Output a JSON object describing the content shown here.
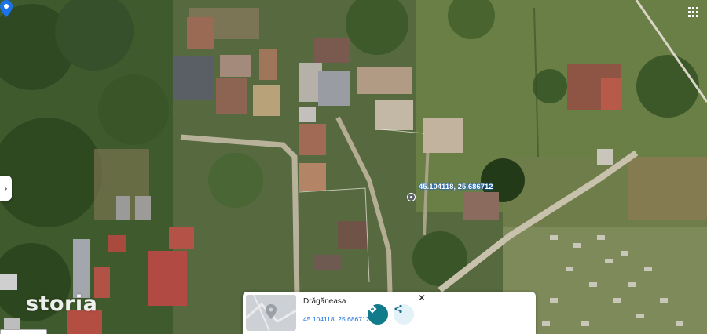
{
  "map": {
    "type": "satellite",
    "pin_label": "45.104118, 25.686712",
    "watermark": "storia"
  },
  "controls": {
    "side_tab_glyph": "›",
    "grid_icon": "apps-grid-icon"
  },
  "place_card": {
    "title": "Drăgăneasa",
    "coordinates": "45.104118, 25.686712",
    "close_glyph": "✕",
    "directions_icon": "directions-icon",
    "share_icon": "share-icon"
  },
  "colors": {
    "pin": "#1a73e8",
    "directions_button": "#117a8b",
    "share_button_bg": "#e3f1f8",
    "coords_text": "#1a73e8"
  }
}
